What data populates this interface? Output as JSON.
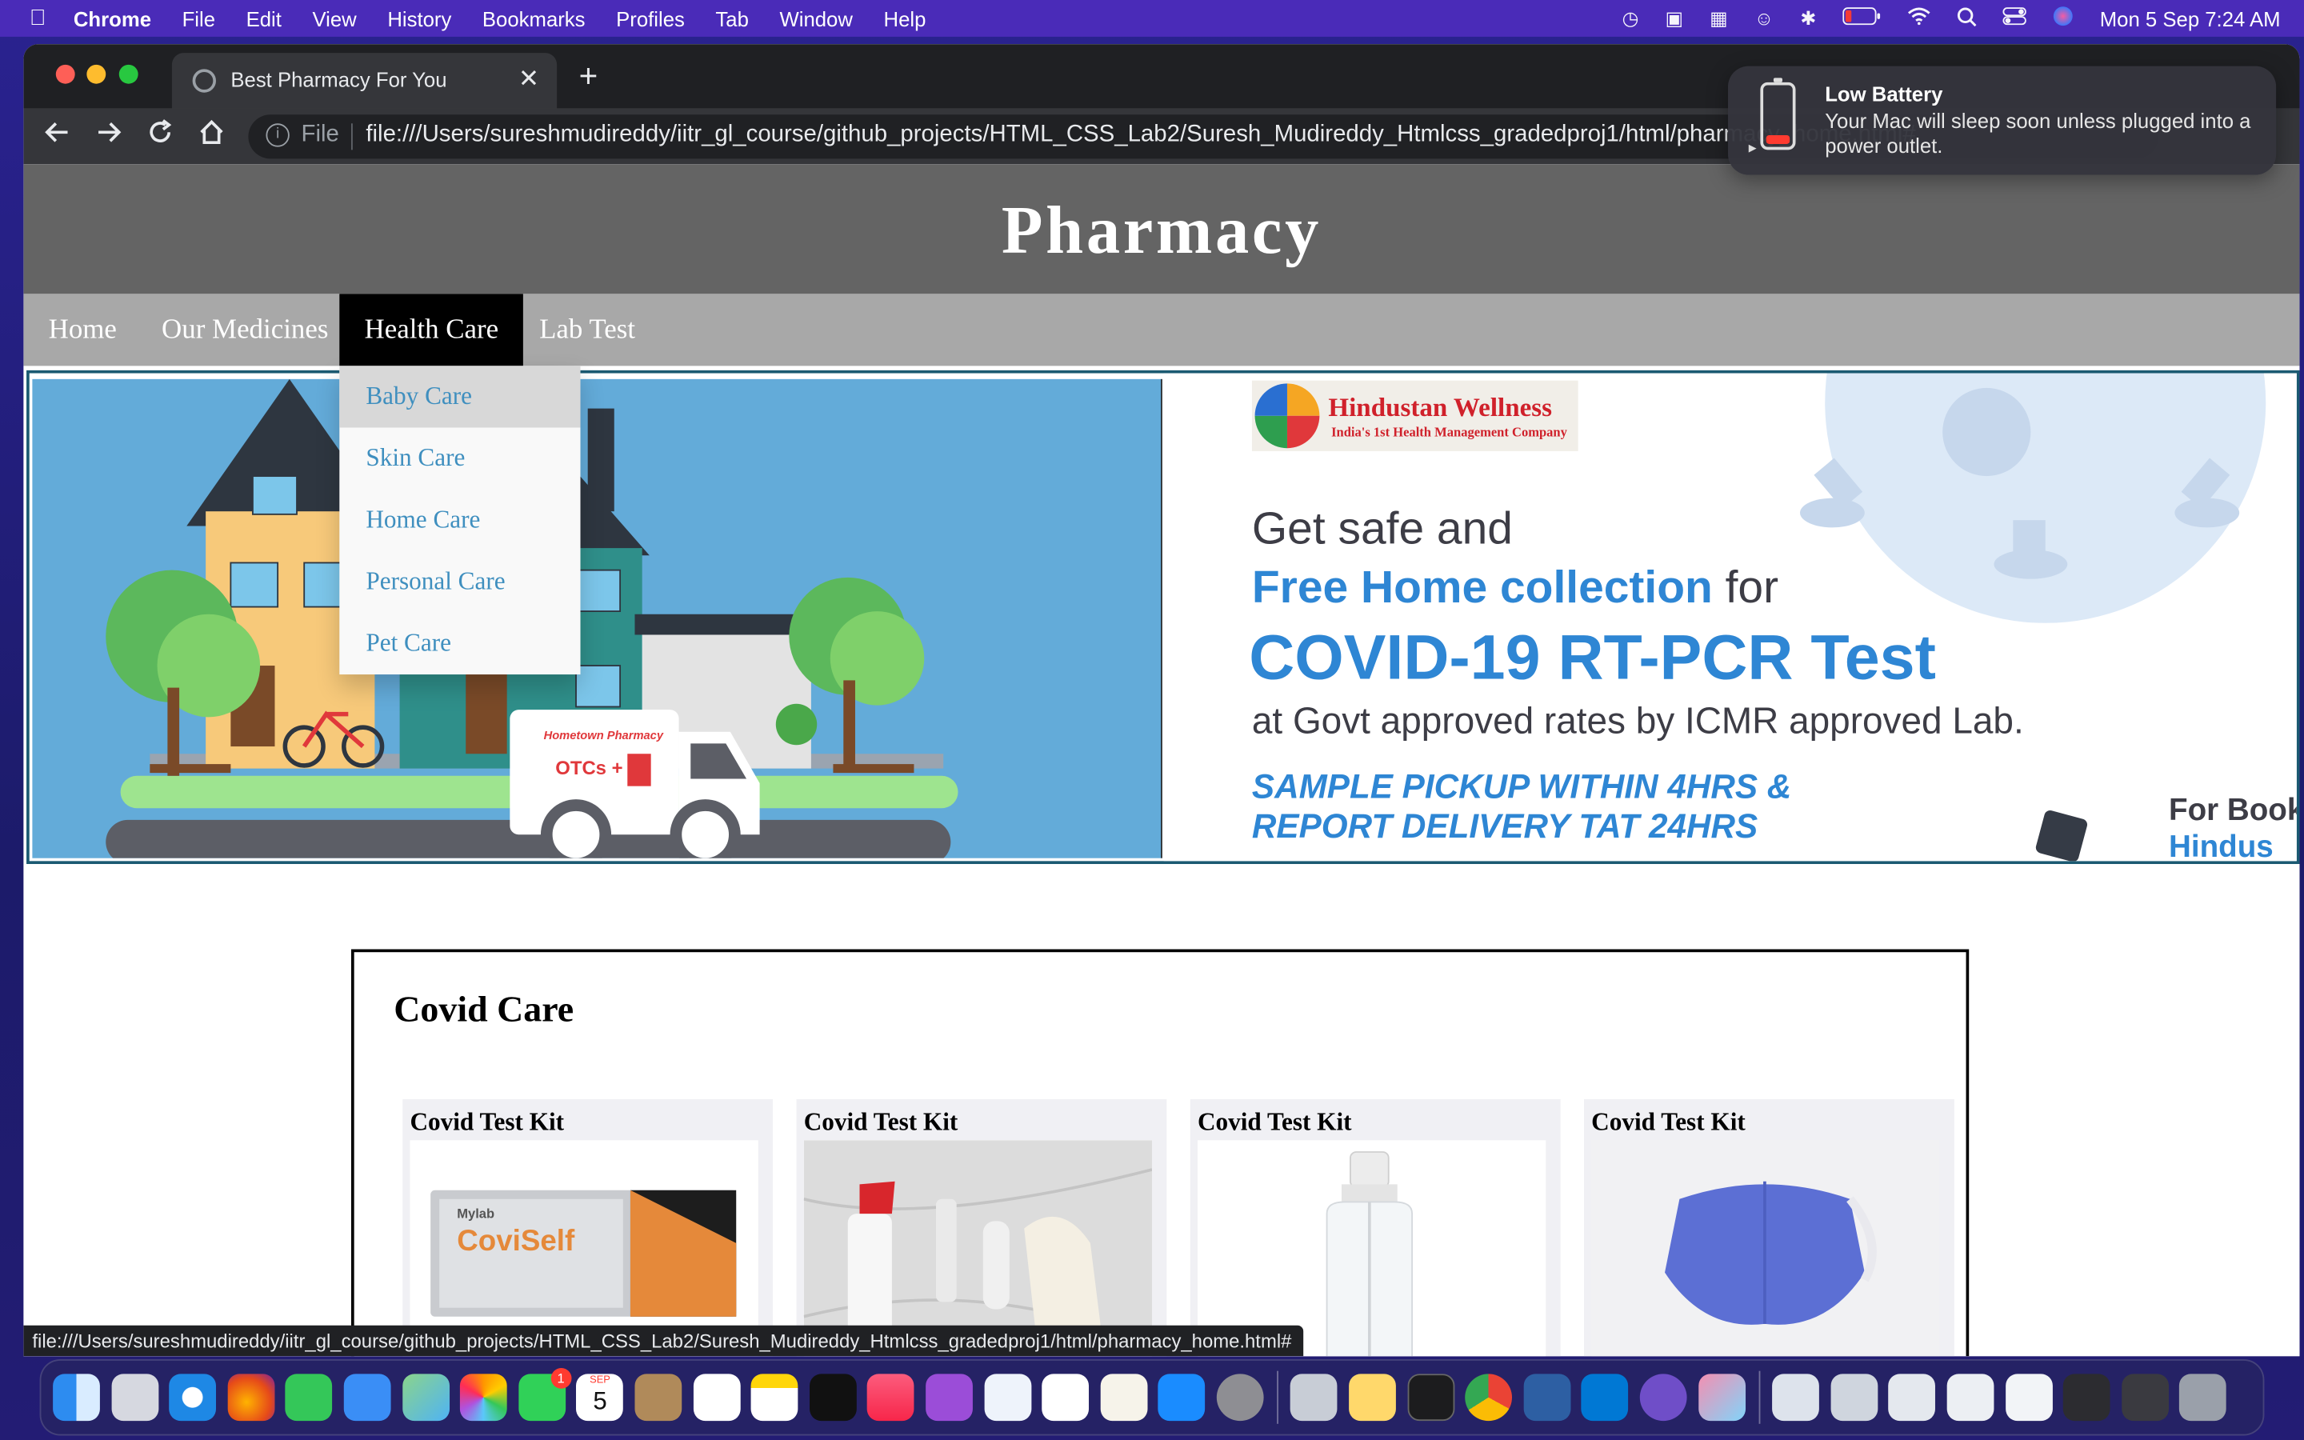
{
  "menubar": {
    "app": "Chrome",
    "items": [
      "File",
      "Edit",
      "View",
      "History",
      "Bookmarks",
      "Profiles",
      "Tab",
      "Window",
      "Help"
    ],
    "clock": "Mon 5 Sep  7:24 AM"
  },
  "browser": {
    "tab_title": "Best Pharmacy For You",
    "scheme": "File",
    "url": "file:///Users/sureshmudireddy/iitr_gl_course/github_projects/HTML_CSS_Lab2/Suresh_Mudireddy_Htmlcss_gradedproj1/html/pharmacy_home.html#",
    "status_url": "file:///Users/sureshmudireddy/iitr_gl_course/github_projects/HTML_CSS_Lab2/Suresh_Mudireddy_Htmlcss_gradedproj1/html/pharmacy_home.html#"
  },
  "site": {
    "title": "Pharmacy",
    "nav": [
      "Home",
      "Our Medicines",
      "Health Care",
      "Lab Test"
    ],
    "dropdown": [
      "Baby Care",
      "Skin Care",
      "Home Care",
      "Personal Care",
      "Pet Care"
    ]
  },
  "banner": {
    "left": {
      "truck_brand": "Hometown Pharmacy",
      "truck_text": "OTCs +"
    },
    "right": {
      "brand": "Hindustan Wellness",
      "tagline": "India's 1st Health Management Company",
      "line1": "Get safe and",
      "line2_highlight": "Free Home collection",
      "line2_rest": "for",
      "line3": "COVID-19 RT-PCR Test",
      "line4": "at Govt approved rates by ICMR approved Lab.",
      "line5": "SAMPLE PICKUP WITHIN 4HRS &",
      "line6": "REPORT DELIVERY TAT 24HRS",
      "edge1": "For Book",
      "edge2": "Hindus"
    }
  },
  "covid": {
    "heading": "Covid Care",
    "cards": [
      {
        "title": "Covid Test Kit",
        "product": "CoviSelf",
        "maker": "Mylab"
      },
      {
        "title": "Covid Test Kit"
      },
      {
        "title": "Covid Test Kit"
      },
      {
        "title": "Covid Test Kit"
      }
    ]
  },
  "notification": {
    "title": "Low Battery",
    "body": "Your Mac will sleep soon unless plugged into a power outlet."
  },
  "dock": {
    "messages_badge": "1",
    "calendar_month": "SEP",
    "calendar_day": "5"
  },
  "colors": {
    "header_bg": "#646464",
    "nav_bg": "#a8a8a8",
    "link_blue": "#3f8fbf",
    "banner_blue": "#2e86d4"
  }
}
